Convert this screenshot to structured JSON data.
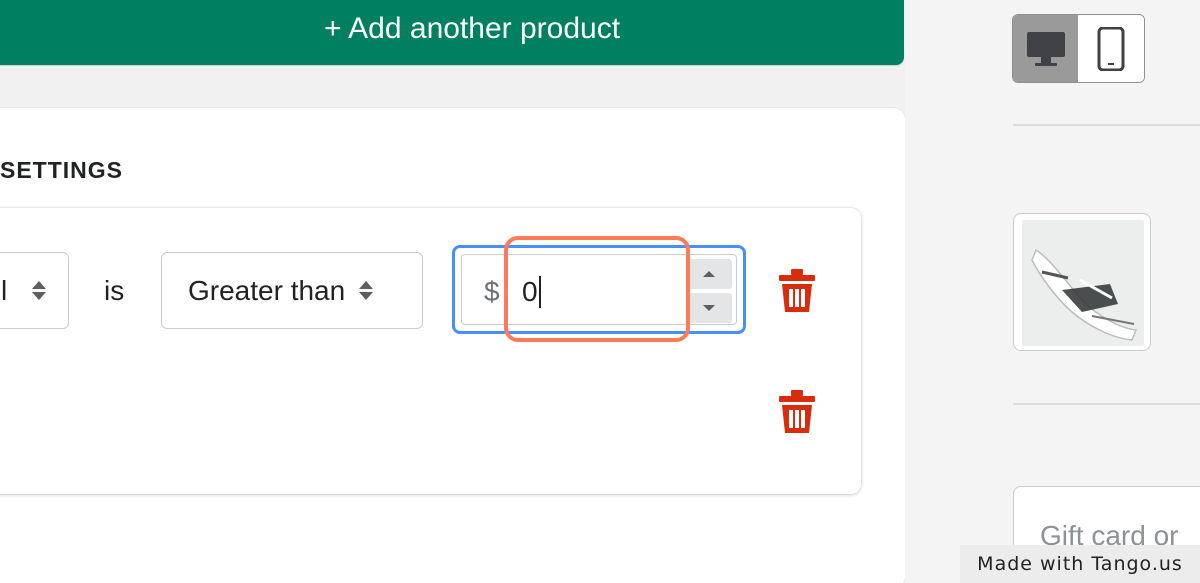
{
  "top_button": {
    "label": "+ Add another product"
  },
  "settings": {
    "title": "SETTINGS",
    "condition_row": {
      "field_select_value": "l",
      "connector_text": "is",
      "operator_select_value": "Greater than",
      "amount_prefix": "$",
      "amount_value": "0"
    }
  },
  "icons": {
    "trash": "trash-icon",
    "desktop": "desktop-icon",
    "mobile": "mobile-icon",
    "select_arrows": "select-arrows-icon"
  },
  "preview": {
    "gift_card_placeholder": "Gift card or"
  },
  "watermark": {
    "text": "Made with Tango.us"
  },
  "colors": {
    "primary_green": "#008060",
    "focus_blue": "#458fff",
    "highlight_orange": "#ff7a59",
    "delete_red": "#d82c0d"
  }
}
